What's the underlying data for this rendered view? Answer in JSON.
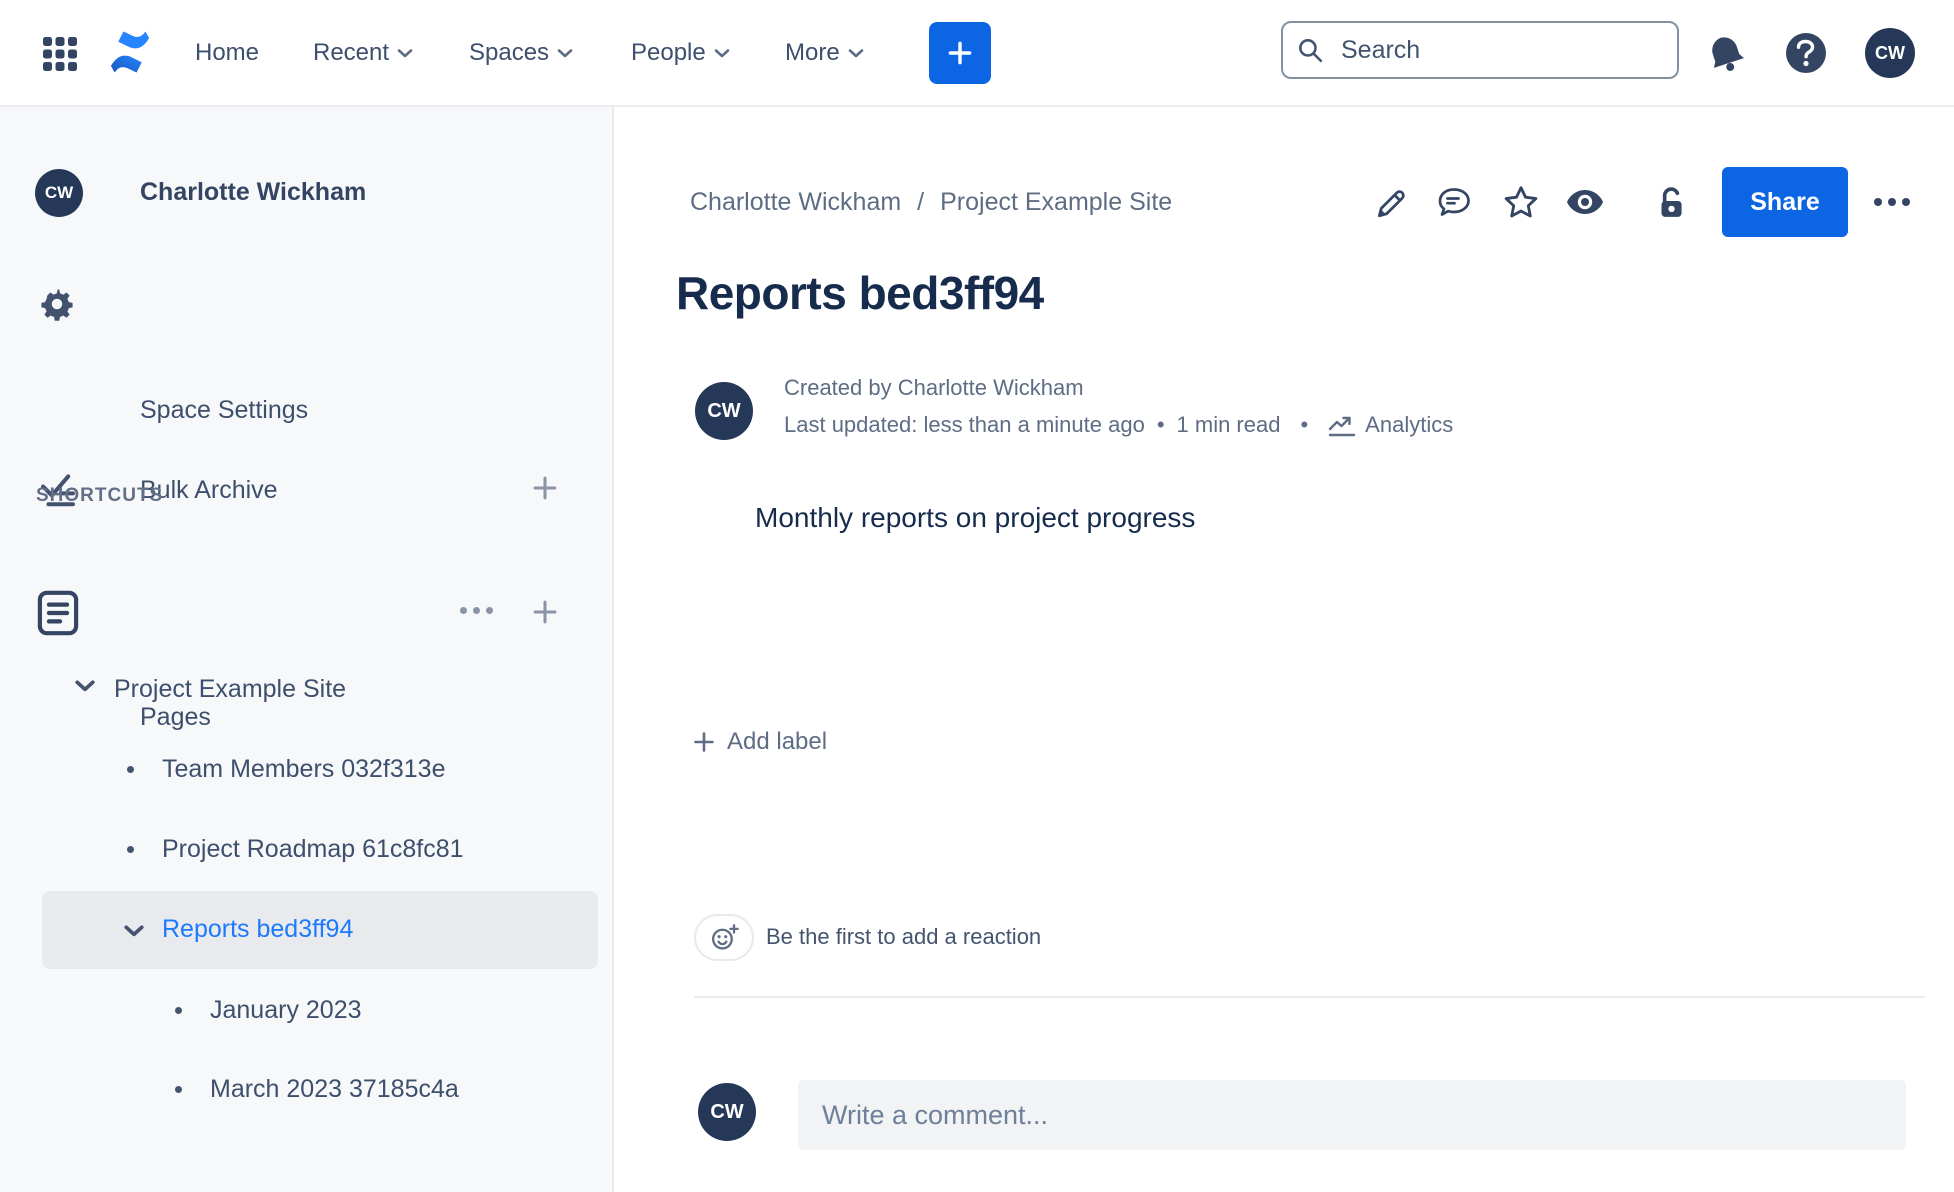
{
  "colors": {
    "accent_blue": "#0c66e4",
    "selected_item_blue": "#1d7afc",
    "avatar_navy": "#253858",
    "icon_navy": "#344563",
    "text_dark": "#172b4d",
    "text_secondary": "#5e6c84",
    "sidebar_bg": "#f7f8f9",
    "selected_bg": "#e9eaee"
  },
  "nav": {
    "links": {
      "home": "Home",
      "recent": "Recent",
      "spaces": "Spaces",
      "people": "People",
      "more": "More"
    },
    "search_placeholder": "Search",
    "help_glyph": "?",
    "avatar_initials": "CW"
  },
  "sidebar": {
    "profile_initials": "CW",
    "profile_name": "Charlotte Wickham",
    "space_settings": "Space Settings",
    "bulk_archive": "Bulk Archive",
    "shortcuts_header": "SHORTCUTS",
    "pages_label": "Pages",
    "tree": {
      "root": "Project Example Site",
      "child_1": "Team Members 032f313e",
      "child_2": "Project Roadmap 61c8fc81",
      "selected": "Reports bed3ff94",
      "grandchild_1": "January 2023",
      "grandchild_2": "March 2023 37185c4a"
    }
  },
  "content": {
    "breadcrumb": {
      "item_1": "Charlotte Wickham",
      "separator": "/",
      "item_2": "Project Example Site"
    },
    "share_button": "Share",
    "title": "Reports bed3ff94",
    "byline": {
      "initials": "CW",
      "created": "Created by Charlotte Wickham",
      "updated": "Last updated: less than a minute ago",
      "dot": "•",
      "read_time": "1 min read",
      "analytics_label": "Analytics"
    },
    "body_text": "Monthly reports on project progress",
    "add_label": "Add label",
    "reaction_prompt": "Be the first to add a reaction",
    "comment": {
      "initials": "CW",
      "placeholder": "Write a comment..."
    }
  }
}
